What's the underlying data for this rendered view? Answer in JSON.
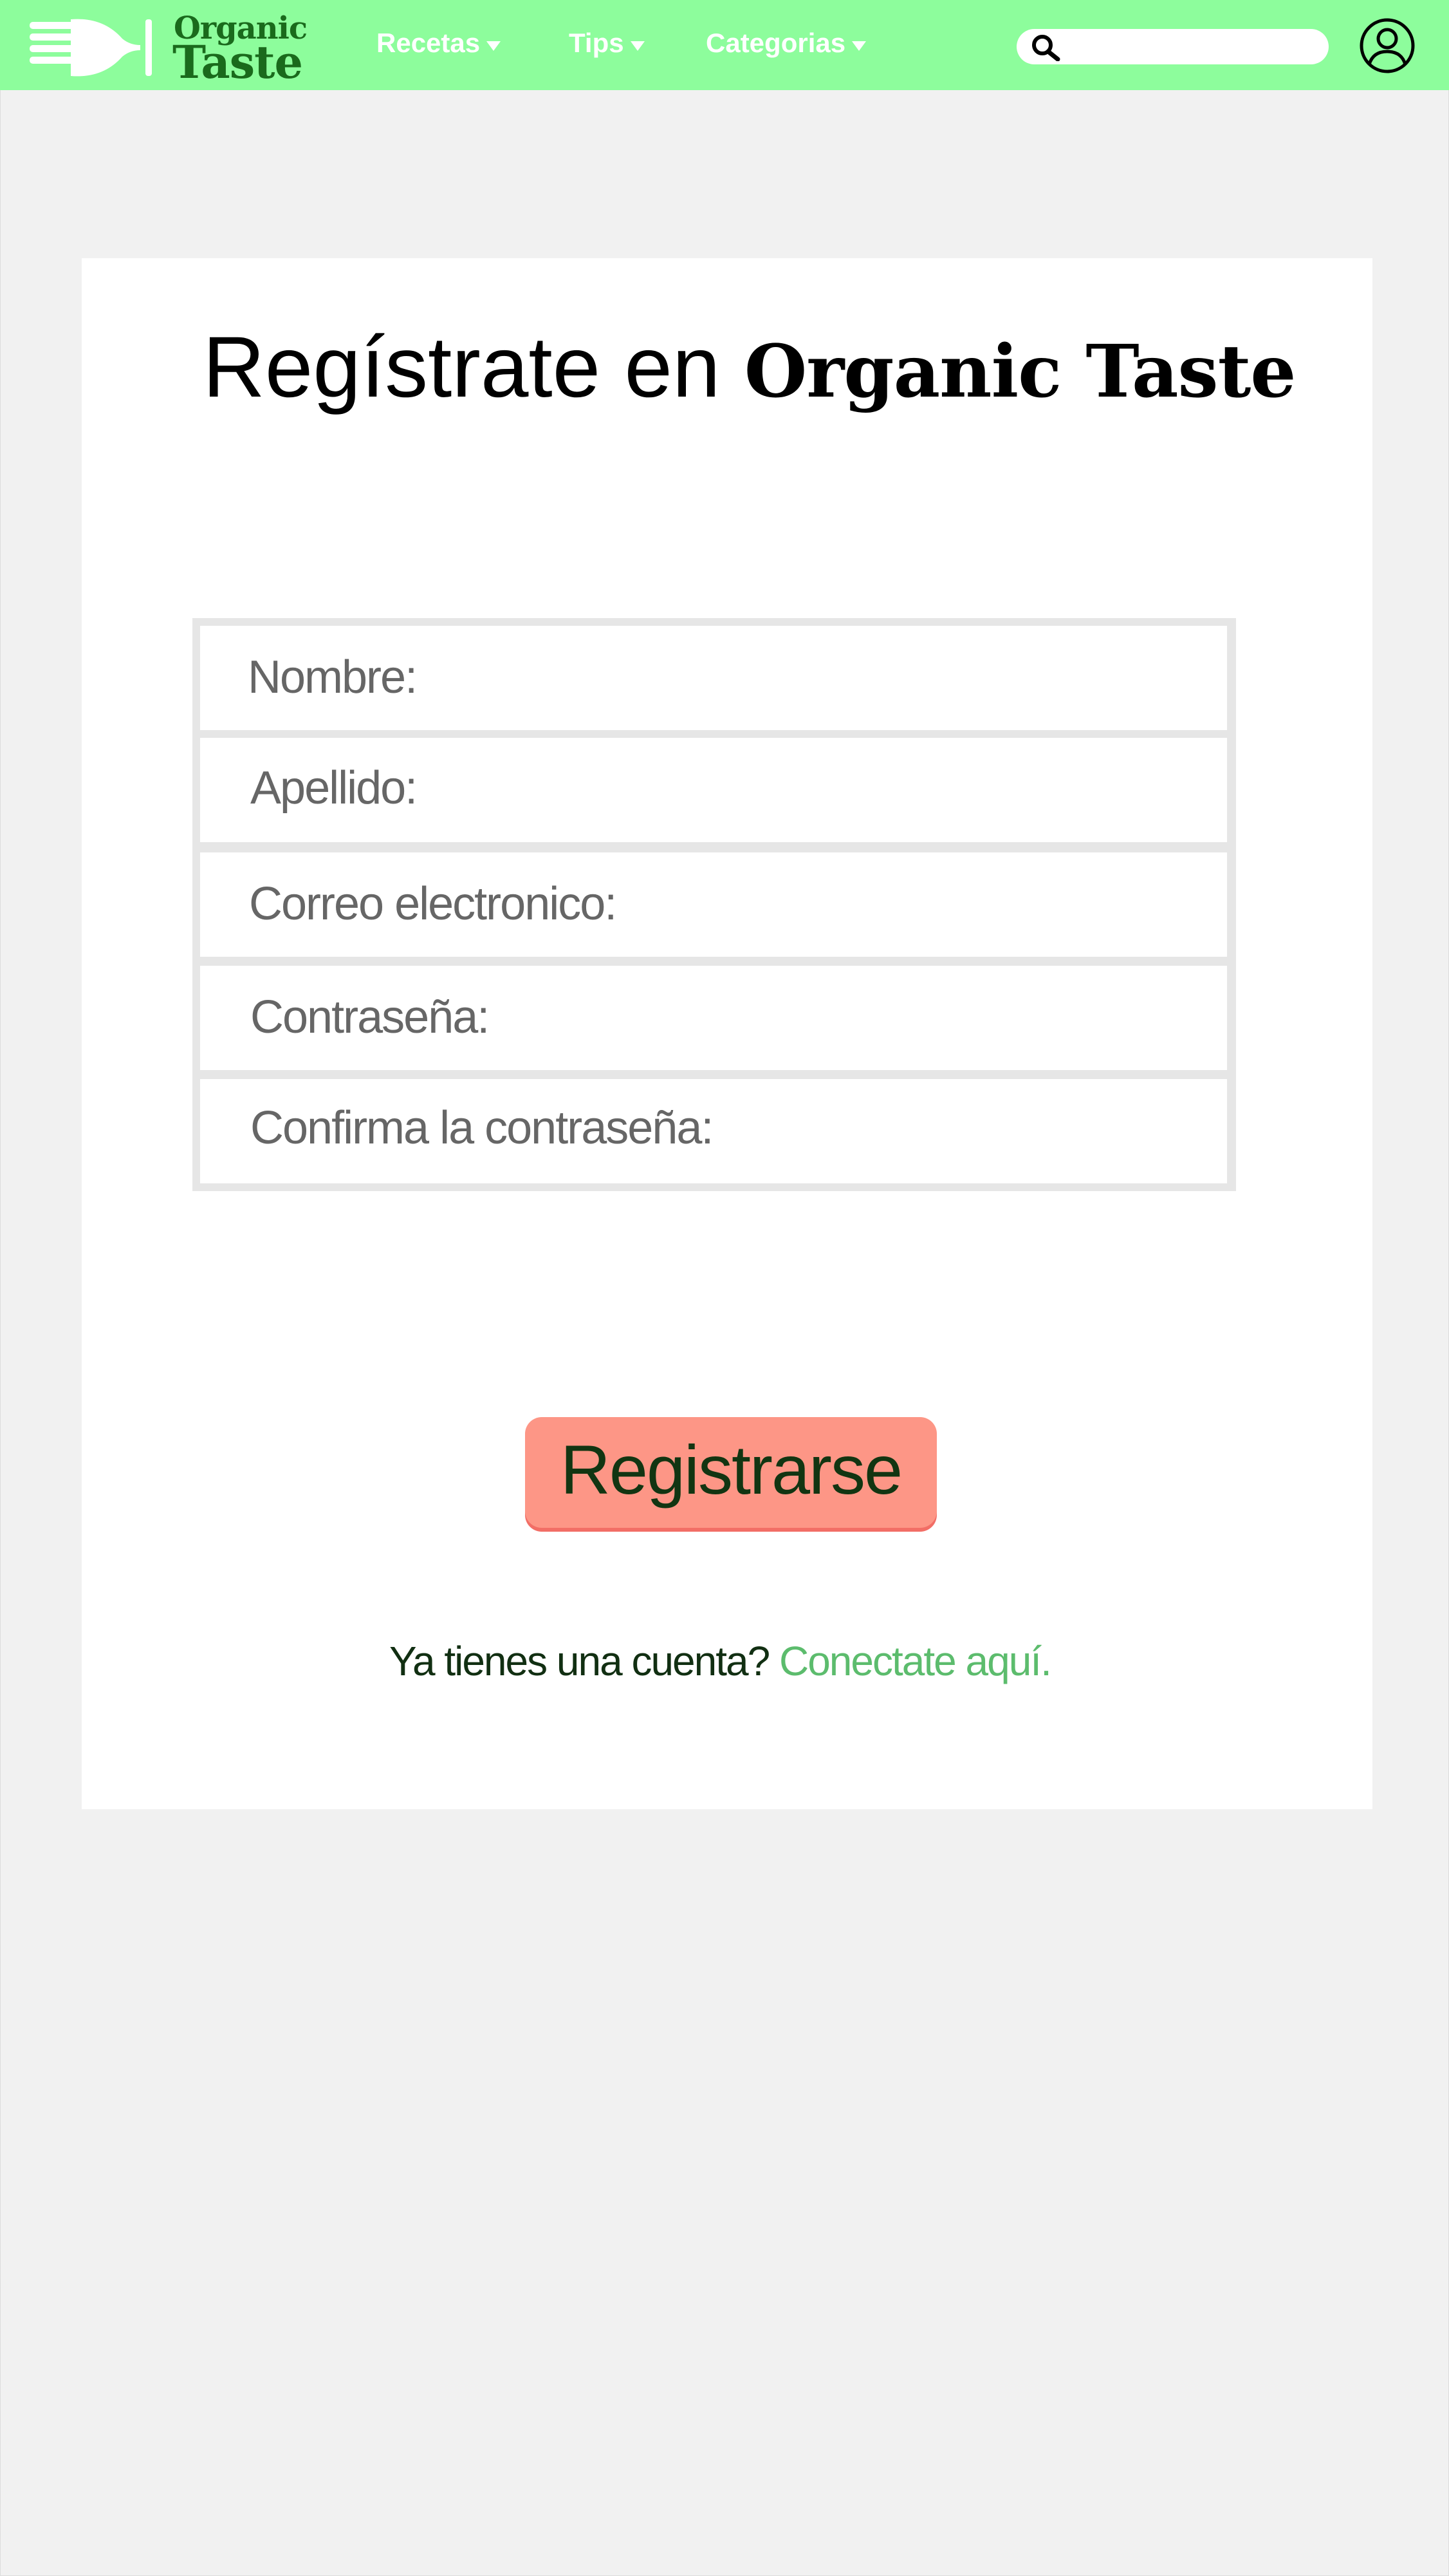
{
  "header": {
    "logo": {
      "line1": "Organic",
      "line2": "Taste"
    },
    "nav": [
      {
        "label": "Recetas"
      },
      {
        "label": "Tips"
      },
      {
        "label": "Categorias"
      }
    ],
    "search": {
      "value": "",
      "placeholder": ""
    }
  },
  "register": {
    "title_prefix": "Regístrate en",
    "title_brand": "Organic Taste",
    "fields": [
      {
        "label": "Nombre:"
      },
      {
        "label": "Apellido:"
      },
      {
        "label": "Correo electronico:"
      },
      {
        "label": "Contraseña:"
      },
      {
        "label": "Confirma la contraseña:"
      }
    ],
    "submit_label": "Registrarse",
    "login_prompt": "Ya tienes una cuenta?",
    "login_link": "Conectate aquí."
  },
  "colors": {
    "header_bg": "#8dfd9c",
    "logo_text": "#1a6a1c",
    "page_bg": "#f1f1f1",
    "button_bg": "#fd9686",
    "button_text": "#123512",
    "link": "#5cbc6d",
    "field_label": "#666666"
  },
  "icons": {
    "logo": "fork-icon",
    "nav_caret": "caret-down-icon",
    "search": "search-icon",
    "user": "user-icon"
  }
}
